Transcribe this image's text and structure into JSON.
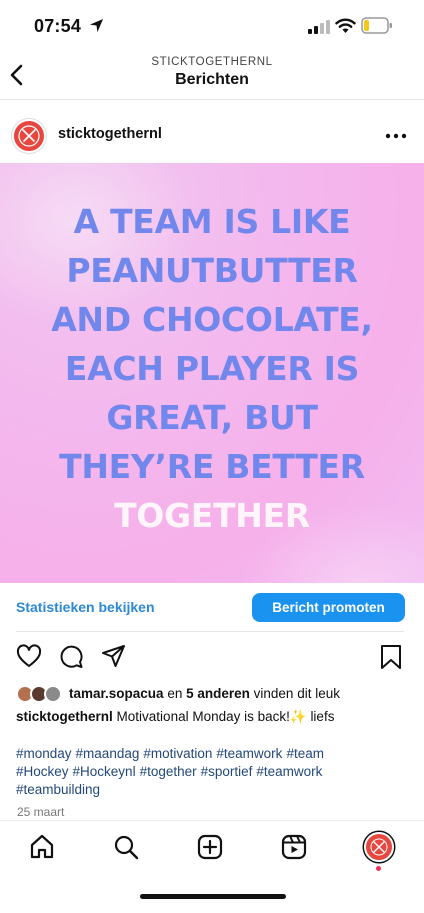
{
  "status_bar": {
    "time": "07:54"
  },
  "header": {
    "account_name": "STICKTOGETHERNL",
    "title": "Berichten"
  },
  "post": {
    "username": "sticktogethernl",
    "image_text": {
      "lines": [
        "A TEAM IS LIKE",
        "PEANUTBUTTER",
        "AND CHOCOLATE,",
        "EACH PLAYER IS",
        "GREAT, BUT",
        "THEY’RE BETTER"
      ],
      "highlight": "TOGETHER"
    },
    "insights_label": "Statistieken bekijken",
    "promote_label": "Bericht promoten",
    "likes": {
      "first_liker": "tamar.sopacua",
      "connector": "en",
      "others": "5 anderen",
      "suffix": "vinden dit leuk"
    },
    "caption": {
      "username": "sticktogethernl",
      "text": "Motivational Monday is back!✨ liefs"
    },
    "hashtags": [
      "#monday",
      "#maandag",
      "#motivation",
      "#teamwork",
      "#team",
      "#Hockey",
      "#Hockeynl",
      "#together",
      "#sportief",
      "#teamwork",
      "#teambuilding"
    ],
    "date": "25 maart"
  },
  "colors": {
    "quote": "#7287ec",
    "accent_blue": "#1a93f0",
    "hashtag": "#23497a",
    "avatar_red": "#e8473f"
  },
  "tab_bar": [
    "home-icon",
    "search-icon",
    "create-icon",
    "reels-icon",
    "profile-avatar"
  ]
}
